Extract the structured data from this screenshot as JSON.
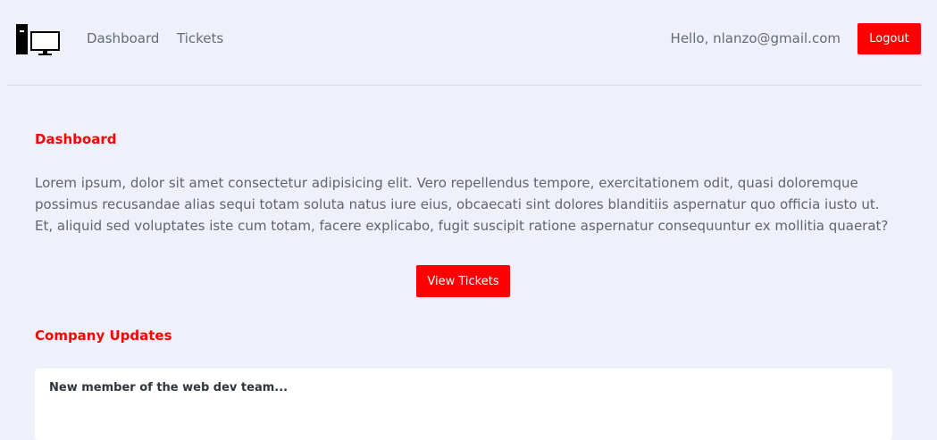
{
  "nav": {
    "logo_icon": "computer-icon",
    "links": [
      "Dashboard",
      "Tickets"
    ],
    "greeting": "Hello, nlanzo@gmail.com",
    "logout_label": "Logout"
  },
  "main": {
    "dashboard_title": "Dashboard",
    "intro_text": "Lorem ipsum, dolor sit amet consectetur adipisicing elit. Vero repellendus tempore, exercitationem odit, quasi doloremque possimus recusandae alias sequi totam soluta natus iure eius, obcaecati sint dolores blanditiis aspernatur quo officia iusto ut. Et, aliquid sed voluptates iste cum totam, facere explicabo, fugit suscipit ratione aspernatur consequuntur ex mollitia quaerat?",
    "view_tickets_label": "View Tickets",
    "updates_title": "Company Updates",
    "updates": [
      {
        "title": "New member of the web dev team..."
      }
    ]
  },
  "colors": {
    "accent": "#ff0000",
    "background": "#eef1f9",
    "card": "#ffffff"
  }
}
